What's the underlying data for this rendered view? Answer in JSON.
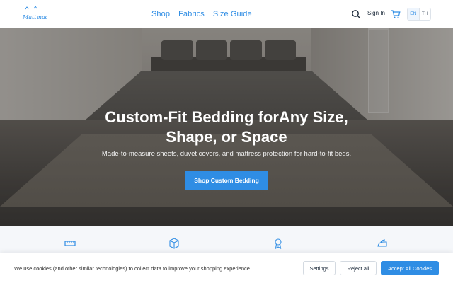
{
  "header": {
    "logo_text": "Mattmade",
    "nav": [
      {
        "label": "Shop"
      },
      {
        "label": "Fabrics"
      },
      {
        "label": "Size Guide"
      }
    ],
    "signin_label": "Sign In",
    "lang": {
      "en": "EN",
      "th": "TH",
      "selected": "EN"
    },
    "accent_color": "#2f8de4"
  },
  "hero": {
    "title_line1": "Custom-Fit Bedding forAny Size,",
    "title_line2": "Shape, or Space",
    "subtitle": "Made-to-measure sheets, duvet covers, and mattress protection for hard-to-fit beds.",
    "cta_label": "Shop Custom Bedding"
  },
  "features": [
    {
      "icon": "ruler-icon"
    },
    {
      "icon": "box-icon"
    },
    {
      "icon": "award-icon"
    },
    {
      "icon": "iron-icon"
    }
  ],
  "cookie": {
    "text": "We use cookies (and other similar technologies) to collect data to improve your shopping experience.",
    "settings_label": "Settings",
    "reject_label": "Reject all",
    "accept_label": "Accept All Cookies"
  }
}
